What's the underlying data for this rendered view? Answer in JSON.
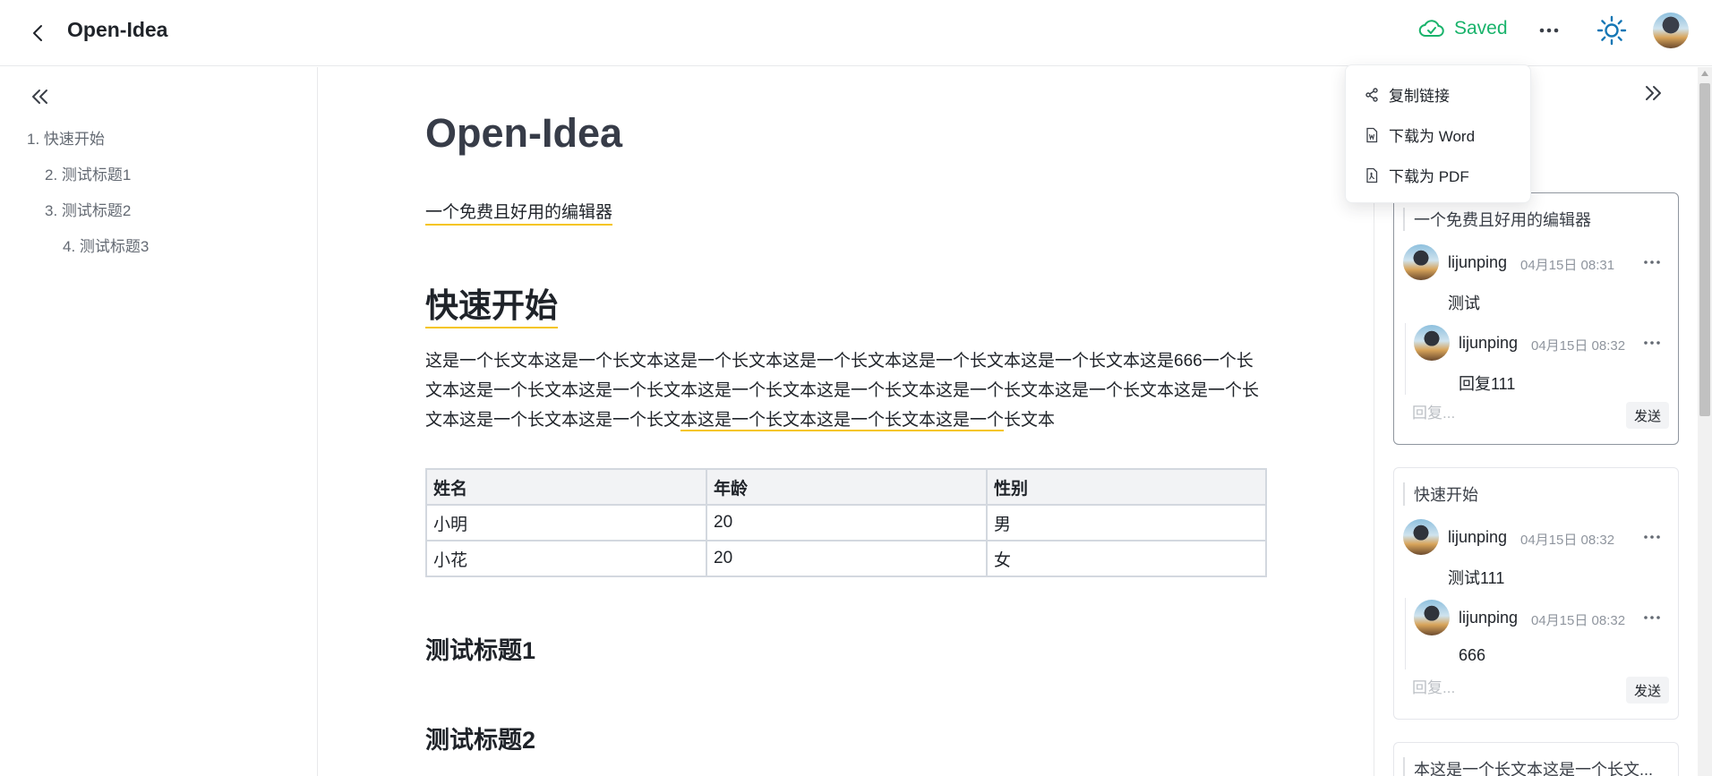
{
  "header": {
    "title": "Open-Idea",
    "saved_label": "Saved",
    "colors": {
      "saved": "#19b36b",
      "theme_icon": "#1677b5"
    }
  },
  "outline": {
    "items": [
      {
        "label": "1. 快速开始",
        "level": 1
      },
      {
        "label": "2. 测试标题1",
        "level": 2
      },
      {
        "label": "3. 测试标题2",
        "level": 2
      },
      {
        "label": "4. 测试标题3",
        "level": 3
      }
    ]
  },
  "document": {
    "title": "Open-Idea",
    "subtitle": "一个免费且好用的编辑器",
    "heading1": "快速开始",
    "paragraph_part1": "这是一个长文本这是一个长文本这是一个长文本这是一个长文本这是一个长文本这是一个长文本这是666一个长文本这是一个长文本这是一个长文本这是一个长文本这是一个长文本这是一个长文本这是一个长文本这是一个长文本这是一个长文本这是一个长文",
    "paragraph_highlight": "本这是一个长文本这是一个长文本这是一个",
    "paragraph_part3": "长文本",
    "table": {
      "headers": [
        "姓名",
        "年龄",
        "性别"
      ],
      "rows": [
        [
          "小明",
          "20",
          "男"
        ],
        [
          "小花",
          "20",
          "女"
        ]
      ]
    },
    "heading_a": "测试标题1",
    "heading_b": "测试标题2"
  },
  "dropdown": {
    "items": [
      {
        "label": "复制链接",
        "icon": "share-icon"
      },
      {
        "label": "下载为 Word",
        "icon": "word-file-icon"
      },
      {
        "label": "下载为 PDF",
        "icon": "pdf-file-icon"
      }
    ]
  },
  "comments": {
    "reply_placeholder": "回复...",
    "send_label": "发送",
    "threads": [
      {
        "quote": "一个免费且好用的编辑器",
        "comments": [
          {
            "user": "lijunping",
            "time": "04月15日 08:31",
            "text": "测试"
          },
          {
            "user": "lijunping",
            "time": "04月15日 08:32",
            "text": "回复111"
          }
        ]
      },
      {
        "quote": "快速开始",
        "comments": [
          {
            "user": "lijunping",
            "time": "04月15日 08:32",
            "text": "测试111"
          },
          {
            "user": "lijunping",
            "time": "04月15日 08:32",
            "text": "666"
          }
        ]
      },
      {
        "quote": "本这是一个长文本这是一个长文..."
      }
    ]
  }
}
